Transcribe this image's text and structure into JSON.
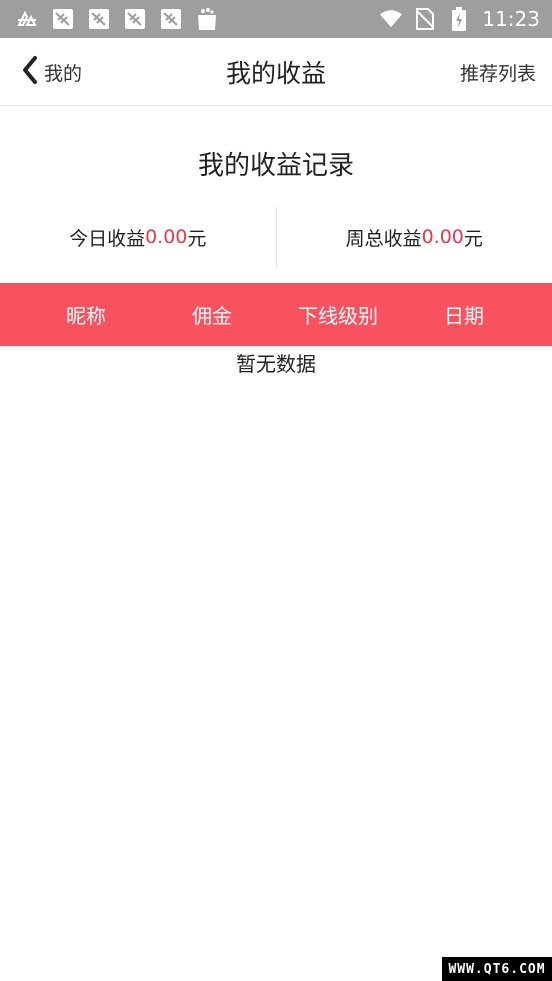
{
  "status_bar": {
    "time": "11:23",
    "icons_left": [
      "app-store-icon",
      "notification-icon",
      "notification-icon",
      "notification-icon",
      "notification-icon",
      "shopping-bag-icon"
    ],
    "icons_right": [
      "wifi-icon",
      "no-sim-icon",
      "battery-charging-icon"
    ]
  },
  "nav": {
    "back_label": "我的",
    "title": "我的收益",
    "right_label": "推荐列表"
  },
  "section_title": "我的收益记录",
  "summary": {
    "today_label": "今日收益",
    "today_amount": "0.00",
    "today_unit": "元",
    "week_label": "周总收益",
    "week_amount": "0.00",
    "week_unit": "元"
  },
  "table": {
    "columns": [
      "昵称",
      "佣金",
      "下线级别",
      "日期"
    ],
    "empty_text": "暂无数据"
  },
  "watermark": "WWW.QT6.COM",
  "colors": {
    "accent": "#f7525e",
    "amount": "#e8394a",
    "status_bar": "#9e9e9e"
  }
}
